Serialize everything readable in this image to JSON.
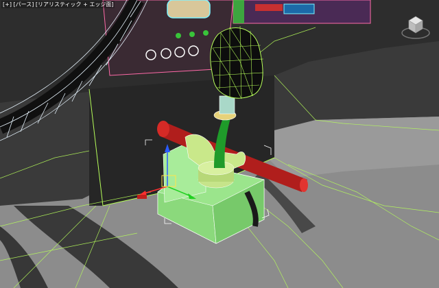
{
  "viewport": {
    "label_parts": [
      "[+]",
      "[パース]",
      "[リアリスティック + エッジ面]"
    ],
    "background_color": "#3a3a3a",
    "floor_color": "#8a8a8a",
    "wire_color_green": "#b7ff5a",
    "wire_color_white": "#e8f5ff",
    "selection_color": "#9be58c",
    "red_handle_color": "#c2201d",
    "shift_stem_color": "#1f9b2a"
  },
  "icons": {
    "viewcube": "viewcube-icon",
    "gizmo": "transform-gizmo-icon"
  }
}
